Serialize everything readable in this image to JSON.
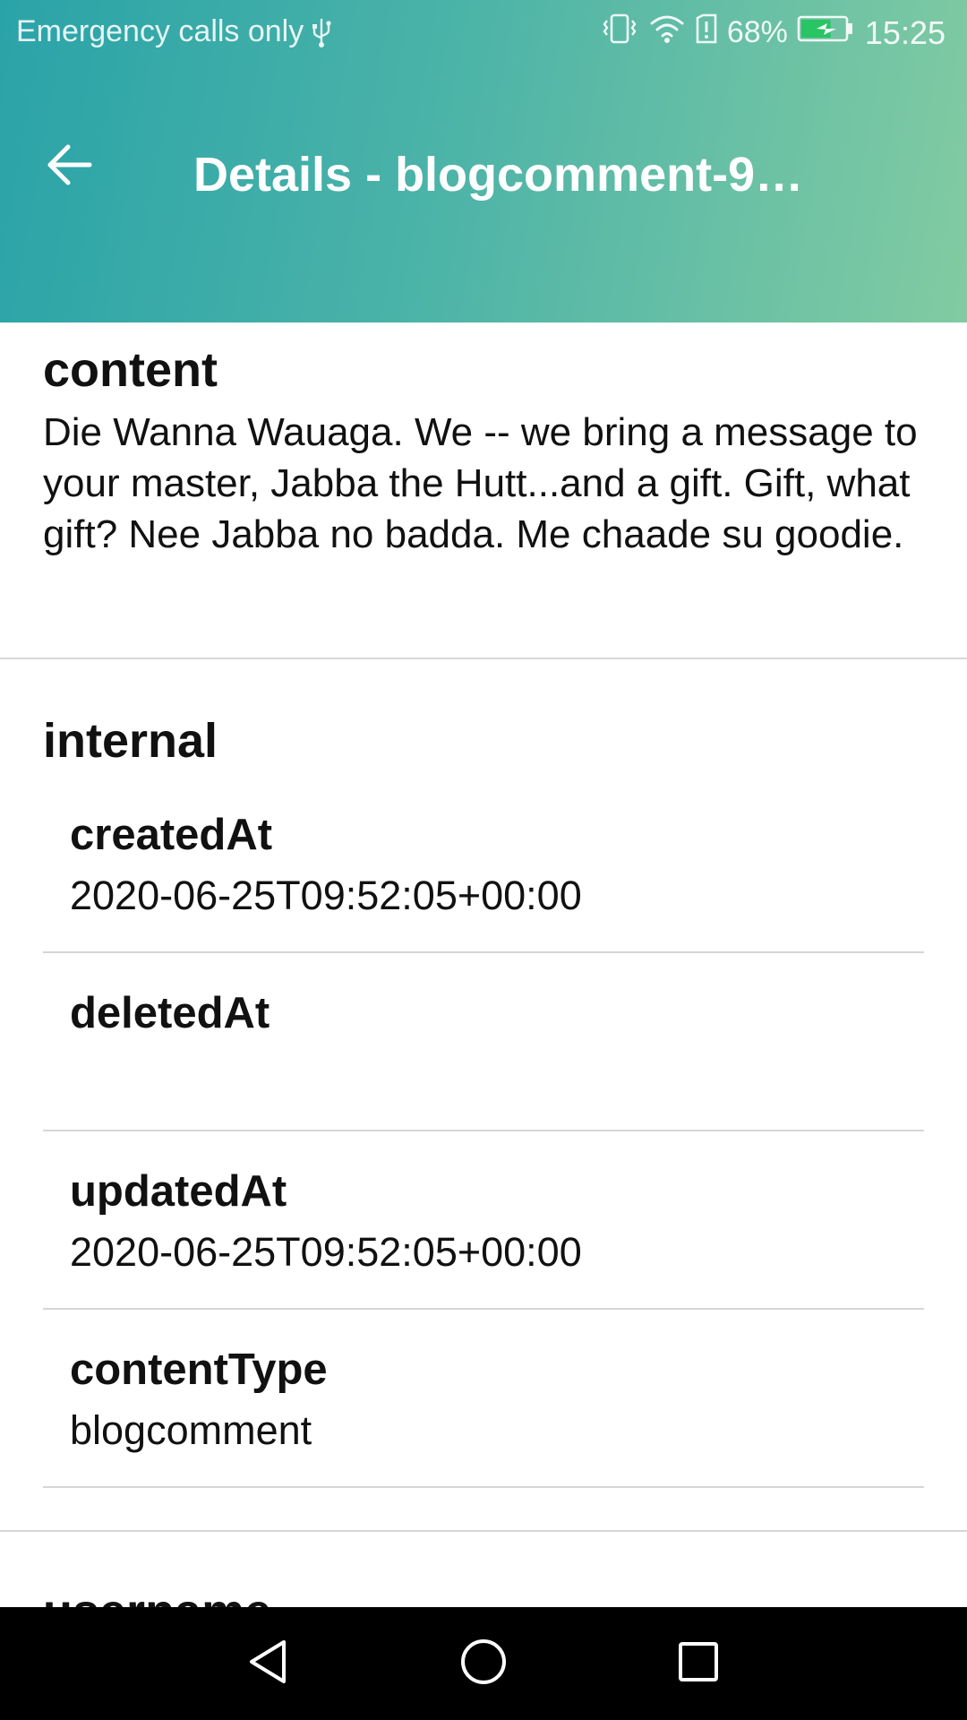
{
  "status_bar": {
    "carrier_text": "Emergency calls only",
    "battery_percent": "68%",
    "battery_level": 0.68,
    "time": "15:25",
    "icons": [
      "usb-icon",
      "vibrate-icon",
      "wifi-icon",
      "sim-alert-icon",
      "battery-charging-icon"
    ]
  },
  "app_bar": {
    "title": "Details - blogcomment-9…",
    "back_icon": "arrow-back-icon"
  },
  "content": {
    "heading": "content",
    "text": "Die Wanna Wauaga. We -- we bring a message to your master, Jabba the Hutt...and a gift. Gift, what gift? Nee Jabba no badda. Me chaade su goodie."
  },
  "internal": {
    "heading": "internal",
    "fields": [
      {
        "name": "createdAt",
        "value": "2020-06-25T09:52:05+00:00"
      },
      {
        "name": "deletedAt",
        "value": ""
      },
      {
        "name": "updatedAt",
        "value": "2020-06-25T09:52:05+00:00"
      },
      {
        "name": "contentType",
        "value": "blogcomment"
      }
    ]
  },
  "next_section": {
    "heading": "username"
  },
  "nav_bar": {
    "icons": [
      "back-triangle-icon",
      "home-circle-icon",
      "recents-square-icon"
    ]
  },
  "colors": {
    "header_start": "#2aa3a8",
    "header_end": "#82cba2",
    "divider": "#d6d6d6",
    "nav_bar": "#000000"
  }
}
